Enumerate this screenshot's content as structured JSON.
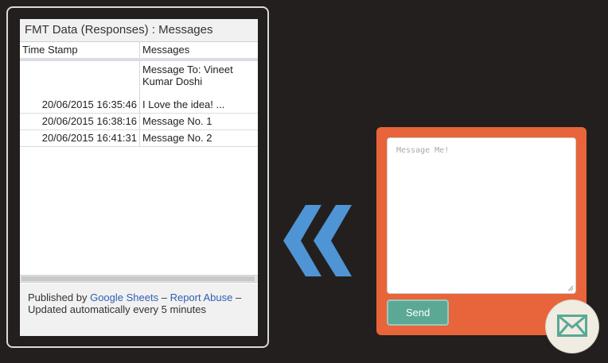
{
  "sheet": {
    "title": "FMT Data (Responses) : Messages",
    "columns": [
      "Time Stamp",
      "Messages"
    ],
    "rows": [
      {
        "timestamp": "",
        "message": "Message To: Vineet Kumar Doshi"
      },
      {
        "timestamp": "20/06/2015 16:35:46",
        "message": "I Love the idea! ..."
      },
      {
        "timestamp": "20/06/2015 16:38:16",
        "message": "Message No. 1"
      },
      {
        "timestamp": "20/06/2015 16:41:31",
        "message": "Message No. 2"
      }
    ],
    "footer": {
      "published_by": "Published by",
      "google_sheets_link": "Google Sheets",
      "separator1": "–",
      "report_abuse_link": "Report Abuse",
      "separator2": "–",
      "updated_text": "Updated automatically every 5 minutes"
    }
  },
  "contact": {
    "message_placeholder": "Message Me!",
    "send_label": "Send"
  },
  "icons": {
    "chevron": "double-chevron-left-icon",
    "mail": "envelope-icon"
  },
  "colors": {
    "background": "#231f1e",
    "card": "#e8643a",
    "send_button": "#5aa895",
    "chevron": "#4f94d4",
    "link": "#2f5fb3"
  }
}
